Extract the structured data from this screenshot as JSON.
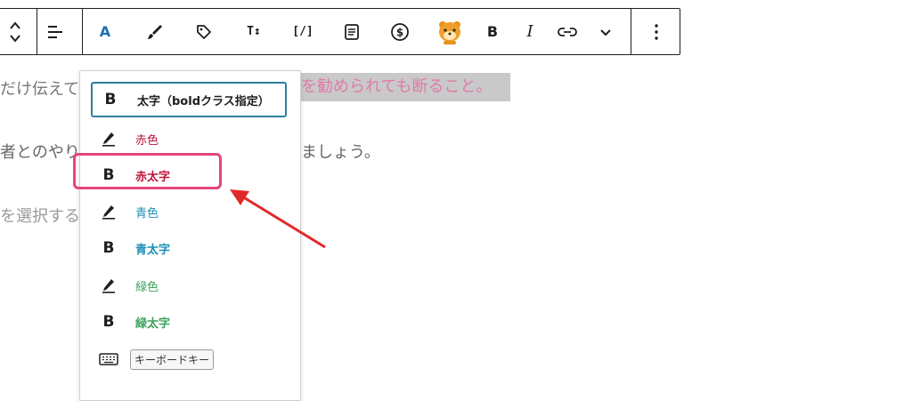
{
  "toolbar": {
    "buttons": [
      {
        "name": "move-up-down-icon"
      },
      {
        "name": "align-icon"
      },
      {
        "name": "text-color-icon",
        "label": "A"
      },
      {
        "name": "brush-icon"
      },
      {
        "name": "tag-icon"
      },
      {
        "name": "text-size-icon",
        "label": "T↕"
      },
      {
        "name": "code-icon",
        "label": "[/]"
      },
      {
        "name": "document-icon"
      },
      {
        "name": "dollar-icon"
      },
      {
        "name": "mascot-icon"
      },
      {
        "name": "bold-icon",
        "label": "B"
      },
      {
        "name": "italic-icon",
        "label": "I"
      },
      {
        "name": "link-icon"
      },
      {
        "name": "chevron-down-icon"
      },
      {
        "name": "more-options-icon"
      }
    ],
    "colors": {
      "accent": "#2271b1",
      "mascot": "#f0a02a"
    }
  },
  "editor": {
    "line1_start": "だけ伝えて",
    "line1_highlight": "を勧められても断ること。",
    "line2_start": "者とのやり",
    "line2_end": "ましょう。",
    "line3_start": "を選択する"
  },
  "menu": {
    "items": [
      {
        "icon": "B",
        "label": "太字（boldクラス指定）",
        "color": "#1e1e1e",
        "bold": true
      },
      {
        "icon": "pen",
        "label": "赤色",
        "color": "#c0143c",
        "bold": false
      },
      {
        "icon": "B",
        "label": "赤太字",
        "color": "#c0143c",
        "bold": true
      },
      {
        "icon": "pen",
        "label": "青色",
        "color": "#1a8fb6",
        "bold": false
      },
      {
        "icon": "B",
        "label": "青太字",
        "color": "#1a8fb6",
        "bold": true
      },
      {
        "icon": "pen",
        "label": "緑色",
        "color": "#3aa35c",
        "bold": false
      },
      {
        "icon": "B",
        "label": "緑太字",
        "color": "#3aa35c",
        "bold": true
      },
      {
        "icon": "keyboard",
        "label": "キーボードキー",
        "color": "#333333",
        "bold": false
      }
    ],
    "highlight_color": "#e5467a",
    "focus_color": "#2c7f9b"
  }
}
